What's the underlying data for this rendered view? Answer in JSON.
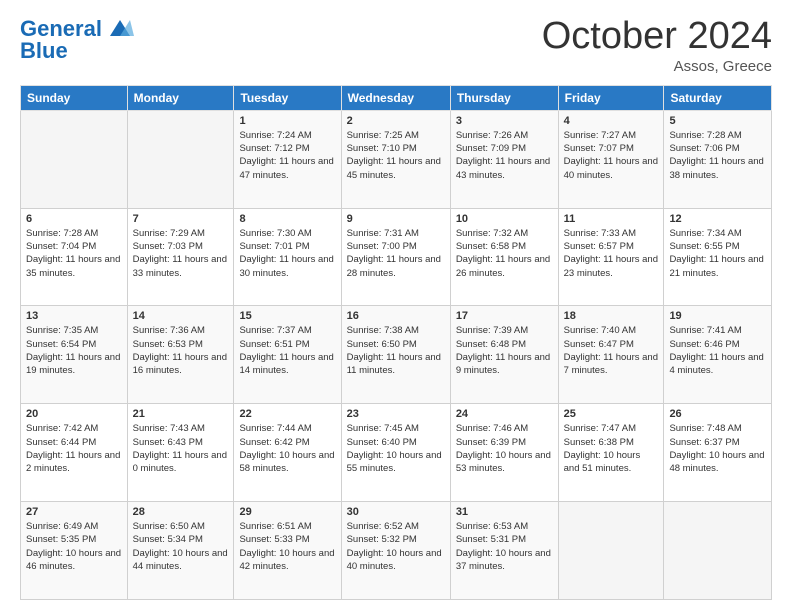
{
  "header": {
    "logo_line1": "General",
    "logo_line2": "Blue",
    "month": "October 2024",
    "location": "Assos, Greece"
  },
  "weekdays": [
    "Sunday",
    "Monday",
    "Tuesday",
    "Wednesday",
    "Thursday",
    "Friday",
    "Saturday"
  ],
  "weeks": [
    [
      {
        "day": "",
        "sunrise": "",
        "sunset": "",
        "daylight": ""
      },
      {
        "day": "",
        "sunrise": "",
        "sunset": "",
        "daylight": ""
      },
      {
        "day": "1",
        "sunrise": "Sunrise: 7:24 AM",
        "sunset": "Sunset: 7:12 PM",
        "daylight": "Daylight: 11 hours and 47 minutes."
      },
      {
        "day": "2",
        "sunrise": "Sunrise: 7:25 AM",
        "sunset": "Sunset: 7:10 PM",
        "daylight": "Daylight: 11 hours and 45 minutes."
      },
      {
        "day": "3",
        "sunrise": "Sunrise: 7:26 AM",
        "sunset": "Sunset: 7:09 PM",
        "daylight": "Daylight: 11 hours and 43 minutes."
      },
      {
        "day": "4",
        "sunrise": "Sunrise: 7:27 AM",
        "sunset": "Sunset: 7:07 PM",
        "daylight": "Daylight: 11 hours and 40 minutes."
      },
      {
        "day": "5",
        "sunrise": "Sunrise: 7:28 AM",
        "sunset": "Sunset: 7:06 PM",
        "daylight": "Daylight: 11 hours and 38 minutes."
      }
    ],
    [
      {
        "day": "6",
        "sunrise": "Sunrise: 7:28 AM",
        "sunset": "Sunset: 7:04 PM",
        "daylight": "Daylight: 11 hours and 35 minutes."
      },
      {
        "day": "7",
        "sunrise": "Sunrise: 7:29 AM",
        "sunset": "Sunset: 7:03 PM",
        "daylight": "Daylight: 11 hours and 33 minutes."
      },
      {
        "day": "8",
        "sunrise": "Sunrise: 7:30 AM",
        "sunset": "Sunset: 7:01 PM",
        "daylight": "Daylight: 11 hours and 30 minutes."
      },
      {
        "day": "9",
        "sunrise": "Sunrise: 7:31 AM",
        "sunset": "Sunset: 7:00 PM",
        "daylight": "Daylight: 11 hours and 28 minutes."
      },
      {
        "day": "10",
        "sunrise": "Sunrise: 7:32 AM",
        "sunset": "Sunset: 6:58 PM",
        "daylight": "Daylight: 11 hours and 26 minutes."
      },
      {
        "day": "11",
        "sunrise": "Sunrise: 7:33 AM",
        "sunset": "Sunset: 6:57 PM",
        "daylight": "Daylight: 11 hours and 23 minutes."
      },
      {
        "day": "12",
        "sunrise": "Sunrise: 7:34 AM",
        "sunset": "Sunset: 6:55 PM",
        "daylight": "Daylight: 11 hours and 21 minutes."
      }
    ],
    [
      {
        "day": "13",
        "sunrise": "Sunrise: 7:35 AM",
        "sunset": "Sunset: 6:54 PM",
        "daylight": "Daylight: 11 hours and 19 minutes."
      },
      {
        "day": "14",
        "sunrise": "Sunrise: 7:36 AM",
        "sunset": "Sunset: 6:53 PM",
        "daylight": "Daylight: 11 hours and 16 minutes."
      },
      {
        "day": "15",
        "sunrise": "Sunrise: 7:37 AM",
        "sunset": "Sunset: 6:51 PM",
        "daylight": "Daylight: 11 hours and 14 minutes."
      },
      {
        "day": "16",
        "sunrise": "Sunrise: 7:38 AM",
        "sunset": "Sunset: 6:50 PM",
        "daylight": "Daylight: 11 hours and 11 minutes."
      },
      {
        "day": "17",
        "sunrise": "Sunrise: 7:39 AM",
        "sunset": "Sunset: 6:48 PM",
        "daylight": "Daylight: 11 hours and 9 minutes."
      },
      {
        "day": "18",
        "sunrise": "Sunrise: 7:40 AM",
        "sunset": "Sunset: 6:47 PM",
        "daylight": "Daylight: 11 hours and 7 minutes."
      },
      {
        "day": "19",
        "sunrise": "Sunrise: 7:41 AM",
        "sunset": "Sunset: 6:46 PM",
        "daylight": "Daylight: 11 hours and 4 minutes."
      }
    ],
    [
      {
        "day": "20",
        "sunrise": "Sunrise: 7:42 AM",
        "sunset": "Sunset: 6:44 PM",
        "daylight": "Daylight: 11 hours and 2 minutes."
      },
      {
        "day": "21",
        "sunrise": "Sunrise: 7:43 AM",
        "sunset": "Sunset: 6:43 PM",
        "daylight": "Daylight: 11 hours and 0 minutes."
      },
      {
        "day": "22",
        "sunrise": "Sunrise: 7:44 AM",
        "sunset": "Sunset: 6:42 PM",
        "daylight": "Daylight: 10 hours and 58 minutes."
      },
      {
        "day": "23",
        "sunrise": "Sunrise: 7:45 AM",
        "sunset": "Sunset: 6:40 PM",
        "daylight": "Daylight: 10 hours and 55 minutes."
      },
      {
        "day": "24",
        "sunrise": "Sunrise: 7:46 AM",
        "sunset": "Sunset: 6:39 PM",
        "daylight": "Daylight: 10 hours and 53 minutes."
      },
      {
        "day": "25",
        "sunrise": "Sunrise: 7:47 AM",
        "sunset": "Sunset: 6:38 PM",
        "daylight": "Daylight: 10 hours and 51 minutes."
      },
      {
        "day": "26",
        "sunrise": "Sunrise: 7:48 AM",
        "sunset": "Sunset: 6:37 PM",
        "daylight": "Daylight: 10 hours and 48 minutes."
      }
    ],
    [
      {
        "day": "27",
        "sunrise": "Sunrise: 6:49 AM",
        "sunset": "Sunset: 5:35 PM",
        "daylight": "Daylight: 10 hours and 46 minutes."
      },
      {
        "day": "28",
        "sunrise": "Sunrise: 6:50 AM",
        "sunset": "Sunset: 5:34 PM",
        "daylight": "Daylight: 10 hours and 44 minutes."
      },
      {
        "day": "29",
        "sunrise": "Sunrise: 6:51 AM",
        "sunset": "Sunset: 5:33 PM",
        "daylight": "Daylight: 10 hours and 42 minutes."
      },
      {
        "day": "30",
        "sunrise": "Sunrise: 6:52 AM",
        "sunset": "Sunset: 5:32 PM",
        "daylight": "Daylight: 10 hours and 40 minutes."
      },
      {
        "day": "31",
        "sunrise": "Sunrise: 6:53 AM",
        "sunset": "Sunset: 5:31 PM",
        "daylight": "Daylight: 10 hours and 37 minutes."
      },
      {
        "day": "",
        "sunrise": "",
        "sunset": "",
        "daylight": ""
      },
      {
        "day": "",
        "sunrise": "",
        "sunset": "",
        "daylight": ""
      }
    ]
  ]
}
